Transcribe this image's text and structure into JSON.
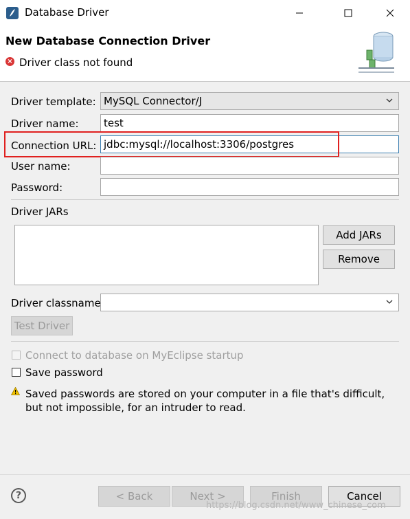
{
  "window": {
    "title": "Database Driver"
  },
  "header": {
    "heading": "New Database Connection Driver",
    "error_message": "Driver class not found"
  },
  "form": {
    "driver_template_label": "Driver template:",
    "driver_template_value": "MySQL Connector/J",
    "driver_name_label": "Driver name:",
    "driver_name_value": "test",
    "connection_url_label": "Connection URL:",
    "connection_url_value": "jdbc:mysql://localhost:3306/postgres",
    "user_name_label": "User name:",
    "user_name_value": "",
    "password_label": "Password:",
    "password_value": "",
    "driver_jars_label": "Driver JARs",
    "add_jars_label": "Add JARs",
    "remove_label": "Remove",
    "driver_classname_label": "Driver classname:",
    "driver_classname_value": "",
    "test_driver_label": "Test Driver",
    "connect_on_startup_label": "Connect to database on MyEclipse startup",
    "save_password_label": "Save password",
    "warning_text": "Saved passwords are stored on your computer in a file that's difficult, but not impossible, for an intruder to read."
  },
  "footer": {
    "back_label": "< Back",
    "next_label": "Next >",
    "finish_label": "Finish",
    "cancel_label": "Cancel"
  },
  "watermark": "https://blog.csdn.net/www_chinese_com",
  "colors": {
    "highlight": "#e0201f",
    "focus_border": "#3c7fb1",
    "error": "#d93636",
    "warning": "#f2c200"
  }
}
